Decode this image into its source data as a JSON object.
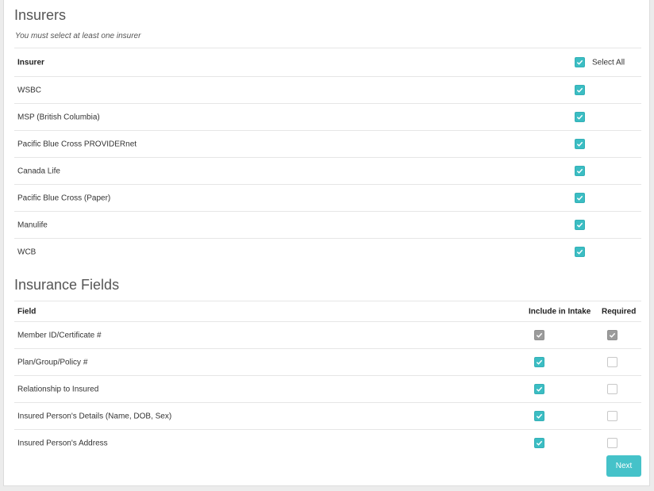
{
  "insurers": {
    "title": "Insurers",
    "hint": "You must select at least one insurer",
    "column_header": "Insurer",
    "select_all_label": "Select All",
    "select_all_checked": true,
    "items": [
      {
        "name": "WSBC",
        "checked": true
      },
      {
        "name": "MSP (British Columbia)",
        "checked": true
      },
      {
        "name": "Pacific Blue Cross PROVIDERnet",
        "checked": true
      },
      {
        "name": "Canada Life",
        "checked": true
      },
      {
        "name": "Pacific Blue Cross (Paper)",
        "checked": true
      },
      {
        "name": "Manulife",
        "checked": true
      },
      {
        "name": "WCB",
        "checked": true
      }
    ]
  },
  "fields": {
    "title": "Insurance Fields",
    "column_field": "Field",
    "column_include": "Include in Intake",
    "column_required": "Required",
    "items": [
      {
        "name": "Member ID/Certificate #",
        "include": "locked",
        "required": "locked"
      },
      {
        "name": "Plan/Group/Policy #",
        "include": "checked",
        "required": "unchecked"
      },
      {
        "name": "Relationship to Insured",
        "include": "checked",
        "required": "unchecked"
      },
      {
        "name": "Insured Person's Details (Name, DOB, Sex)",
        "include": "checked",
        "required": "unchecked"
      },
      {
        "name": "Insured Person's Address",
        "include": "checked",
        "required": "unchecked"
      }
    ]
  },
  "next_button": {
    "label": "Next"
  },
  "colors": {
    "accent": "#45c2c9",
    "checked": "#3bbdc3",
    "locked": "#9b9b9b",
    "background": "#ececec"
  }
}
